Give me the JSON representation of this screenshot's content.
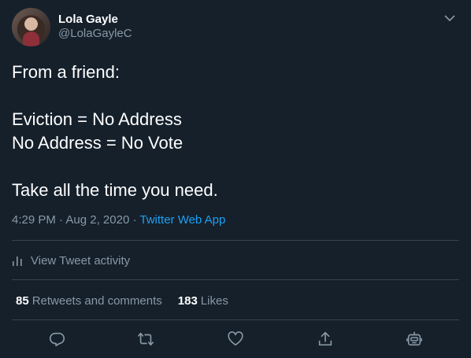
{
  "author": {
    "display_name": "Lola Gayle",
    "handle": "@LolaGayleC"
  },
  "tweet": {
    "lines": [
      "From a friend:",
      "",
      "Eviction = No Address",
      "No Address = No Vote",
      "",
      "Take all the time you need."
    ],
    "time": "4:29 PM",
    "separator1": " · ",
    "date": "Aug 2, 2020",
    "separator2": " · ",
    "source": "Twitter Web App"
  },
  "activity_label": "View Tweet activity",
  "stats": {
    "retweets_count": "85",
    "retweets_label": "Retweets and comments",
    "likes_count": "183",
    "likes_label": "Likes"
  },
  "colors": {
    "background": "#15202b",
    "text": "#ffffff",
    "secondary_text": "#8899a6",
    "link": "#1da1f2",
    "divider": "#38444d"
  },
  "icons": [
    "chevron-down-icon",
    "bar-chart-icon",
    "reply-icon",
    "retweet-icon",
    "like-icon",
    "share-icon",
    "bot-icon"
  ]
}
